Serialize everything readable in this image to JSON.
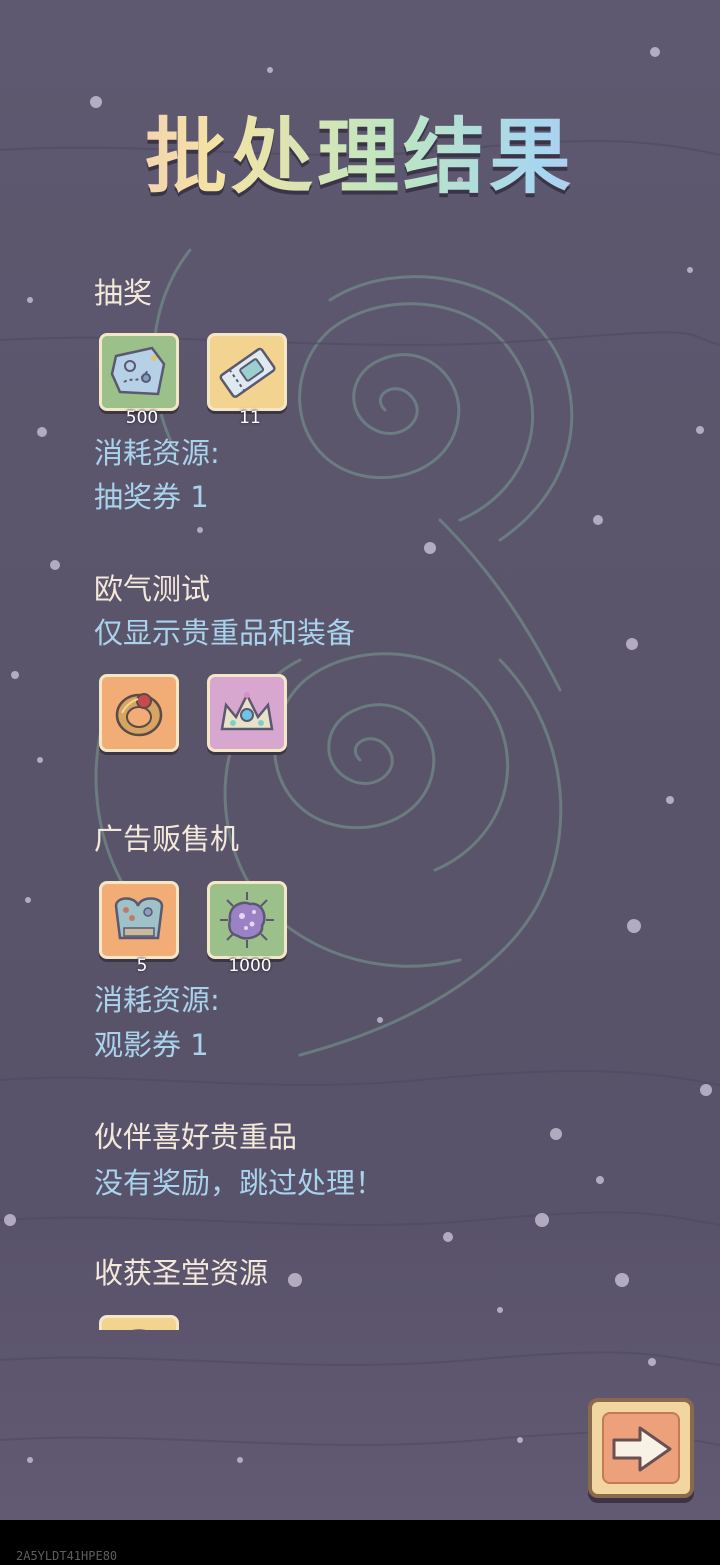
{
  "title": "批处理结果",
  "sections": {
    "lottery": {
      "heading": "抽奖",
      "items": [
        {
          "icon": "treasure-map-icon",
          "count": "500"
        },
        {
          "icon": "ticket-icon",
          "count": "11"
        }
      ],
      "cost_label": "消耗资源:",
      "cost_value": "抽奖券 1"
    },
    "luck_test": {
      "heading": "欧气测试",
      "note": "仅显示贵重品和装备",
      "items": [
        {
          "icon": "ring-icon"
        },
        {
          "icon": "crown-icon"
        }
      ]
    },
    "ad_vending": {
      "heading": "广告贩售机",
      "items": [
        {
          "icon": "armor-icon",
          "count": "5"
        },
        {
          "icon": "spiky-gem-icon",
          "count": "1000"
        }
      ],
      "cost_label": "消耗资源:",
      "cost_value": "观影券 1"
    },
    "companion": {
      "heading": "伙伴喜好贵重品",
      "note": "没有奖励，跳过处理！"
    },
    "harvest": {
      "heading": "收获圣堂资源"
    }
  },
  "next_button": {
    "icon": "arrow-right-icon"
  },
  "watermark": "2A5YLDT41HPE80",
  "colors": {
    "background": "#5c566c",
    "heading_text": "#f2e9da",
    "info_text": "#a9d3ec",
    "swirl": "#7fae9c"
  }
}
